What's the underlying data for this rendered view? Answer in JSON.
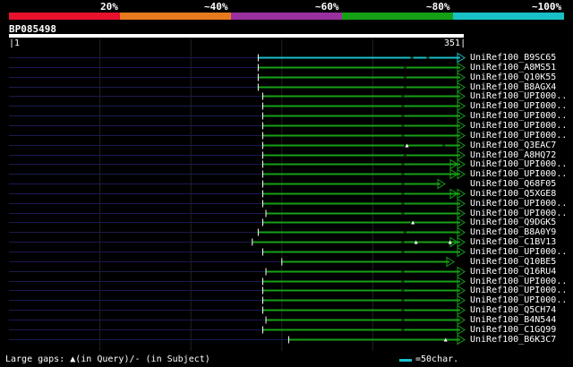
{
  "legend": {
    "segments": [
      {
        "color": "#e8112d",
        "label": "20%"
      },
      {
        "color": "#e87a1e",
        "label": "~40%"
      },
      {
        "color": "#9a2fa0",
        "label": "~60%"
      },
      {
        "color": "#16a016",
        "label": "~80%"
      },
      {
        "color": "#18c0c8",
        "label": "~100%"
      }
    ]
  },
  "query": {
    "id": "BP085498",
    "start": "1",
    "end": "351"
  },
  "hits": [
    {
      "label": "UniRef100_B9SC65",
      "start": 0.548,
      "color": "#18c0c8",
      "marks": [
        0.885,
        0.92
      ],
      "arrow": "line"
    },
    {
      "label": "UniRef100_A8MS51",
      "start": 0.548,
      "color": "#16a016",
      "marks": [
        0.87
      ],
      "arrow": "line"
    },
    {
      "label": "UniRef100_Q10K55",
      "start": 0.548,
      "color": "#16a016",
      "marks": [
        0.87
      ],
      "arrow": "line"
    },
    {
      "label": "UniRef100_B8AGX4",
      "start": 0.548,
      "color": "#16a016",
      "marks": [
        0.87
      ],
      "arrow": "line"
    },
    {
      "label": "UniRef100_UPI000..",
      "start": 0.558,
      "color": "#16a016",
      "marks": [
        0.865
      ],
      "arrow": "line"
    },
    {
      "label": "UniRef100_UPI000..",
      "start": 0.558,
      "color": "#16a016",
      "marks": [
        0.865
      ],
      "arrow": "line"
    },
    {
      "label": "UniRef100_UPI000..",
      "start": 0.558,
      "color": "#16a016",
      "marks": [
        0.865
      ],
      "arrow": "line"
    },
    {
      "label": "UniRef100_UPI000..",
      "start": 0.558,
      "color": "#16a016",
      "marks": [
        0.865
      ],
      "arrow": "line"
    },
    {
      "label": "UniRef100_UPI000..",
      "start": 0.558,
      "color": "#16a016",
      "marks": [
        0.865
      ],
      "arrow": "line"
    },
    {
      "label": "UniRef100_Q3EAC7",
      "start": 0.558,
      "color": "#16a016",
      "marks": [
        0.87,
        0.955
      ],
      "arrow": "line",
      "tri": 0.875
    },
    {
      "label": "UniRef100_A8HQ72",
      "start": 0.558,
      "color": "#16a016",
      "marks": [
        0.87
      ],
      "arrow": "line"
    },
    {
      "label": "UniRef100_UPI000..",
      "start": 0.558,
      "color": "#16a016",
      "marks": [
        0.865
      ],
      "arrow": "double"
    },
    {
      "label": "UniRef100_UPI000..",
      "start": 0.558,
      "color": "#16a016",
      "marks": [
        0.865
      ],
      "arrow": "double"
    },
    {
      "label": "UniRef100_Q68F05",
      "start": 0.558,
      "color": "#16a016",
      "marks": [
        0.865
      ],
      "arrow": "short"
    },
    {
      "label": "UniRef100_Q5XGE8",
      "start": 0.558,
      "color": "#16a016",
      "marks": [
        0.865
      ],
      "arrow": "double"
    },
    {
      "label": "UniRef100_UPI000..",
      "start": 0.558,
      "color": "#16a016",
      "marks": [
        0.865
      ],
      "arrow": "line"
    },
    {
      "label": "UniRef100_UPI000..",
      "start": 0.565,
      "color": "#16a016",
      "marks": [
        0.865
      ],
      "arrow": "line"
    },
    {
      "label": "UniRef100_Q9DGK5",
      "start": 0.558,
      "color": "#16a016",
      "marks": [
        0.885
      ],
      "arrow": "line",
      "tri": 0.888
    },
    {
      "label": "UniRef100_B8A0Y9",
      "start": 0.548,
      "color": "#16a016",
      "marks": [
        0.87
      ],
      "arrow": "line"
    },
    {
      "label": "UniRef100_C1BV13",
      "start": 0.535,
      "color": "#16a016",
      "marks": [
        0.865
      ],
      "arrow": "double",
      "tri": 0.895,
      "tri2": 0.97
    },
    {
      "label": "UniRef100_UPI000..",
      "start": 0.558,
      "color": "#16a016",
      "marks": [
        0.865
      ],
      "arrow": "line"
    },
    {
      "label": "UniRef100_Q10BE5",
      "start": 0.6,
      "color": "#16a016",
      "marks": [],
      "arrow": "short2"
    },
    {
      "label": "UniRef100_Q16RU4",
      "start": 0.565,
      "color": "#16a016",
      "marks": [
        0.865
      ],
      "arrow": "line"
    },
    {
      "label": "UniRef100_UPI000..",
      "start": 0.558,
      "color": "#16a016",
      "marks": [
        0.865
      ],
      "arrow": "line"
    },
    {
      "label": "UniRef100_UPI000..",
      "start": 0.558,
      "color": "#16a016",
      "marks": [
        0.865
      ],
      "arrow": "line"
    },
    {
      "label": "UniRef100_UPI000..",
      "start": 0.558,
      "color": "#16a016",
      "marks": [
        0.865
      ],
      "arrow": "line"
    },
    {
      "label": "UniRef100_Q5CH74",
      "start": 0.558,
      "color": "#16a016",
      "marks": [
        0.865
      ],
      "arrow": "line"
    },
    {
      "label": "UniRef100_B4N544",
      "start": 0.565,
      "color": "#16a016",
      "marks": [
        0.865
      ],
      "arrow": "line"
    },
    {
      "label": "UniRef100_C1GQ99",
      "start": 0.558,
      "color": "#16a016",
      "marks": [
        0.865
      ],
      "arrow": "line"
    },
    {
      "label": "UniRef100_B6K3C7",
      "start": 0.615,
      "color": "#16a016",
      "marks": [],
      "arrow": "line",
      "tri": 0.96
    }
  ],
  "footer": {
    "gaps_text": "Large gaps: ▲(in Query)/- (in Subject)",
    "scale_text": "=50char.",
    "scale_color": "#18c0d0"
  }
}
